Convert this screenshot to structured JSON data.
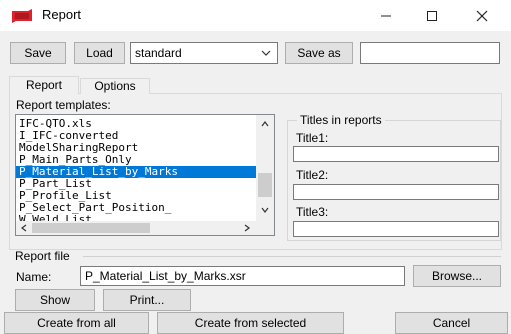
{
  "window": {
    "title": "Report"
  },
  "toolbar": {
    "save_label": "Save",
    "load_label": "Load",
    "config_value": "standard",
    "save_as_label": "Save as",
    "save_as_value": ""
  },
  "tabs": [
    {
      "label": "Report",
      "active": true
    },
    {
      "label": "Options",
      "active": false
    }
  ],
  "templates": {
    "label": "Report templates:",
    "items": [
      "IFC-QTO.xls",
      "I_IFC-converted",
      "ModelSharingReport",
      "P_Main_Parts_Only",
      "P_Material_List_by_Marks",
      "P_Part_List",
      "P_Profile_List",
      "P_Select_Part_Position_",
      "W_Weld_List"
    ],
    "selected_index": 4
  },
  "titles": {
    "group_label": "Titles in reports",
    "title1_label": "Title1:",
    "title2_label": "Title2:",
    "title3_label": "Title3:",
    "title1_value": "",
    "title2_value": "",
    "title3_value": ""
  },
  "report_file": {
    "group_label": "Report file",
    "name_label": "Name:",
    "name_value": "P_Material_List_by_Marks.xsr",
    "browse_label": "Browse..."
  },
  "actions": {
    "show_label": "Show",
    "print_label": "Print...",
    "create_all_label": "Create from all",
    "create_selected_label": "Create from selected",
    "cancel_label": "Cancel"
  }
}
